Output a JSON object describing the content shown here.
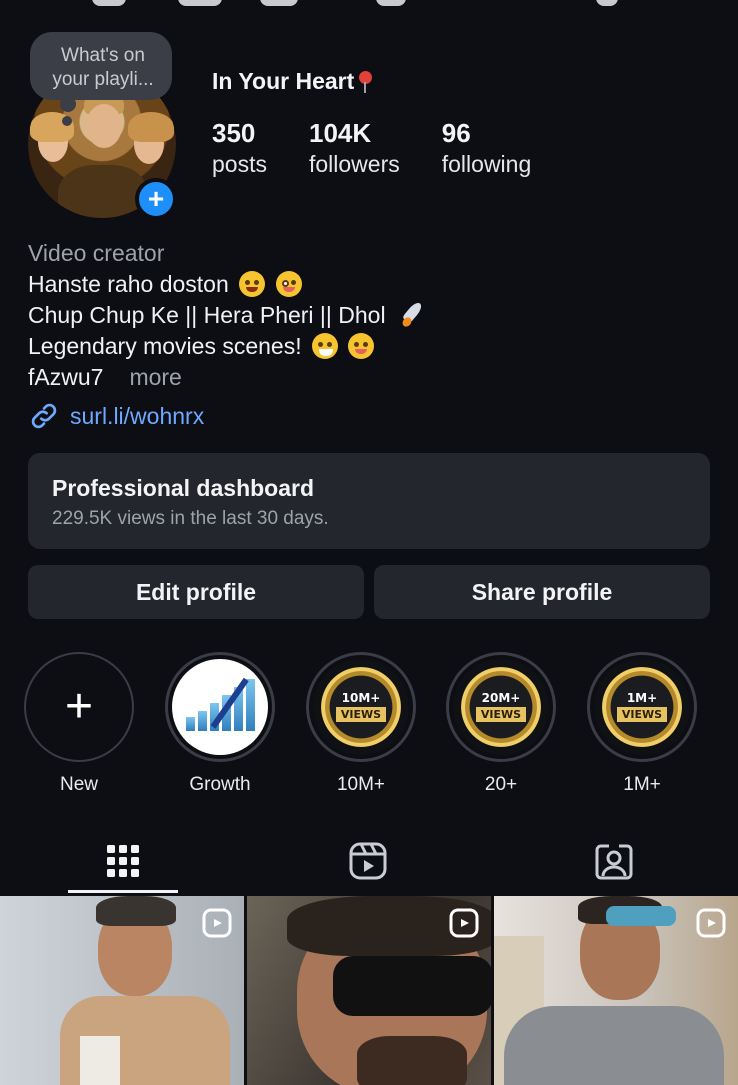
{
  "profile": {
    "note": "What's on your playli...",
    "name": "In Your Heart",
    "stats": [
      {
        "value": "350",
        "label": "posts"
      },
      {
        "value": "104K",
        "label": "followers"
      },
      {
        "value": "96",
        "label": "following"
      }
    ]
  },
  "bio": {
    "category": "Video creator",
    "line1": "Hanste raho doston",
    "line2": "Chup Chup Ke || Hera Pheri || Dhol",
    "line3": "Legendary movies scenes!",
    "line4": "fAzwu7",
    "more": "more"
  },
  "link": {
    "text": "surl.li/wohnrx"
  },
  "dashboard": {
    "title": "Professional dashboard",
    "subtitle": "229.5K views in the last 30 days."
  },
  "buttons": {
    "edit": "Edit profile",
    "share": "Share profile"
  },
  "highlights": [
    {
      "label": "New"
    },
    {
      "label": "Growth"
    },
    {
      "label": "10M+",
      "badge_top": "10M+",
      "badge_ribbon": "VIEWS"
    },
    {
      "label": "20+",
      "badge_top": "20M+",
      "badge_ribbon": "VIEWS"
    },
    {
      "label": "1M+",
      "badge_top": "1M+",
      "badge_ribbon": "VIEWS"
    }
  ],
  "tabs": [
    {
      "icon": "grid-icon",
      "active": true
    },
    {
      "icon": "reels-icon",
      "active": false
    },
    {
      "icon": "tagged-icon",
      "active": false
    }
  ],
  "colors": {
    "background": "#0c0e13",
    "card": "#23262d",
    "link": "#6fa8ff",
    "accent_blue": "#1e8ff8"
  }
}
